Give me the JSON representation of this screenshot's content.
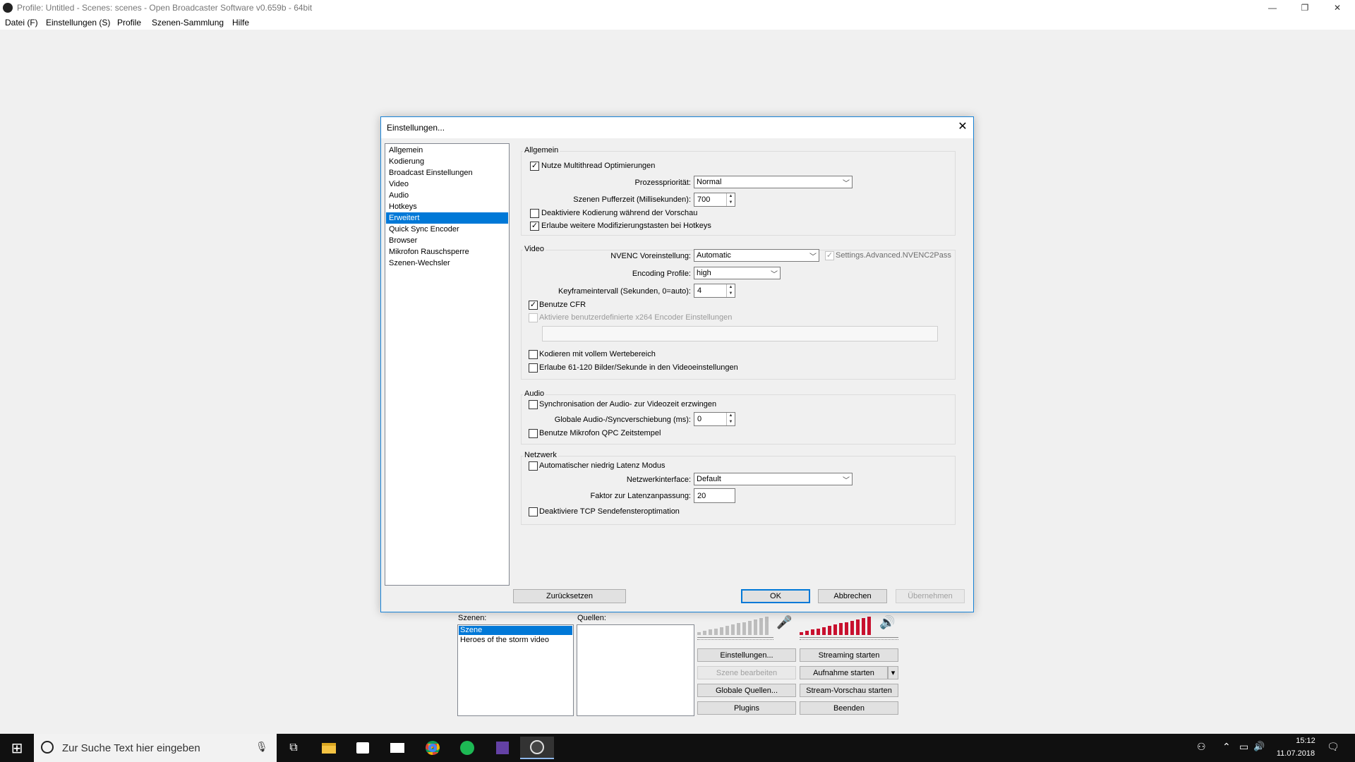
{
  "window": {
    "title": "Profile: Untitled - Scenes: scenes - Open Broadcaster Software v0.659b - 64bit",
    "controls": {
      "minimize": "—",
      "restore": "❐",
      "close": "✕"
    }
  },
  "menu": [
    "Datei (F)",
    "Einstellungen (S)",
    "Profile",
    "Szenen-Sammlung",
    "Hilfe"
  ],
  "dialog": {
    "title": "Einstellungen...",
    "close": "✕",
    "nav": [
      "Allgemein",
      "Kodierung",
      "Broadcast Einstellungen",
      "Video",
      "Audio",
      "Hotkeys",
      "Erweitert",
      "Quick Sync Encoder",
      "Browser",
      "Mikrofon Rauschsperre",
      "Szenen-Wechsler"
    ],
    "nav_selected": "Erweitert",
    "allgemein": {
      "title": "Allgemein",
      "multithread": "Nutze Multithread Optimierungen",
      "priority_label": "Prozesspriorität:",
      "priority_value": "Normal",
      "buffer_label": "Szenen Pufferzeit (Millisekunden):",
      "buffer_value": "700",
      "disable_preview_encoding": "Deaktiviere Kodierung während der Vorschau",
      "allow_modifiers": "Erlaube weitere Modifizierungstasten bei Hotkeys"
    },
    "video": {
      "title": "Video",
      "nvenc_label": "NVENC Voreinstellung:",
      "nvenc_value": "Automatic",
      "nvenc2pass": "Settings.Advanced.NVENC2Pass",
      "profile_label": "Encoding Profile:",
      "profile_value": "high",
      "keyframe_label": "Keyframeintervall (Sekunden, 0=auto):",
      "keyframe_value": "4",
      "cfr": "Benutze CFR",
      "custom_x264": "Aktiviere benutzerdefinierte x264 Encoder Einstellungen",
      "custom_x264_value": "",
      "full_range": "Kodieren mit vollem Wertebereich",
      "allow_high_fps": "Erlaube 61-120 Bilder/Sekunde in den Videoeinstellungen"
    },
    "audio": {
      "title": "Audio",
      "sync": "Synchronisation der Audio- zur Videozeit erzwingen",
      "offset_label": "Globale Audio-/Syncverschiebung (ms):",
      "offset_value": "0",
      "qpc": "Benutze Mikrofon QPC Zeitstempel"
    },
    "netzwerk": {
      "title": "Netzwerk",
      "low_latency": "Automatischer niedrig Latenz Modus",
      "interface_label": "Netzwerkinterface:",
      "interface_value": "Default",
      "latency_label": "Faktor zur Latenzanpassung:",
      "latency_value": "20",
      "tcp": "Deaktiviere TCP Sendefensteroptimation"
    },
    "buttons": {
      "reset": "Zurücksetzen",
      "ok": "OK",
      "cancel": "Abbrechen",
      "apply": "Übernehmen"
    },
    "check": "✓"
  },
  "main": {
    "scenes_label": "Szenen:",
    "sources_label": "Quellen:",
    "scenes": [
      "Szene",
      "Heroes of the storm video"
    ],
    "buttons": {
      "settings": "Einstellungen...",
      "start_stream": "Streaming starten",
      "edit_scene": "Szene bearbeiten",
      "start_record": "Aufnahme starten",
      "global_sources": "Globale Quellen...",
      "preview_stream": "Stream-Vorschau starten",
      "plugins": "Plugins",
      "exit": "Beenden",
      "record_dropdown": "▾"
    },
    "mic_icon": "🎤",
    "speaker_icon": "🔊",
    "colors": {
      "meter_active": "#c8102e",
      "meter_inactive": "#bdbdbd"
    }
  },
  "taskbar": {
    "search_placeholder": "Zur Suche Text hier eingeben",
    "time": "15:12",
    "date": "11.07.2018",
    "start_glyph": "⊞",
    "mic_glyph": "🎙",
    "taskview_glyph": "⧉",
    "tray": {
      "people": "⚇",
      "chevron": "⌃",
      "network": "▭",
      "volume": "🔊",
      "notifications": "🗨"
    },
    "apps": [
      "file-explorer",
      "store",
      "mail",
      "chrome",
      "spotify",
      "twitch",
      "obs"
    ]
  }
}
